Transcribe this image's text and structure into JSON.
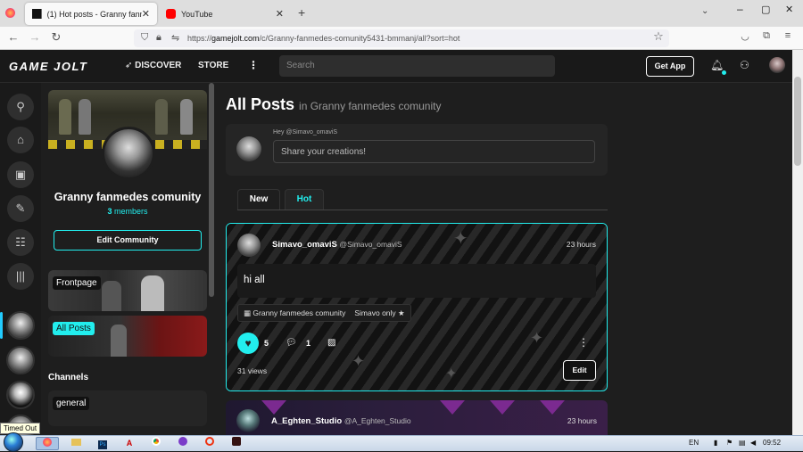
{
  "browser": {
    "tabs": [
      {
        "title": "(1) Hot posts - Granny fanmedes",
        "active": true
      },
      {
        "title": "YouTube",
        "active": false
      }
    ],
    "url_prefix": "https://",
    "url_domain": "gamejolt.com",
    "url_path": "/c/Granny-fanmedes-comunity5431-bmmanj/all?sort=hot"
  },
  "header": {
    "logo": "GAME JOLT",
    "discover": "DISCOVER",
    "store": "STORE",
    "search_placeholder": "Search",
    "get_app": "Get App"
  },
  "rail": {
    "timed_out": "Timed Out"
  },
  "community": {
    "name": "Granny fanmedes comunity",
    "member_count": "3",
    "members_label": "members",
    "edit_button": "Edit Community",
    "channels_heading": "Channels",
    "cards": [
      {
        "label": "Frontpage"
      },
      {
        "label": "All Posts"
      }
    ],
    "channels": [
      {
        "label": "general"
      }
    ]
  },
  "feed": {
    "title": "All Posts",
    "subtitle": "in Granny fanmedes comunity",
    "composer": {
      "hey": "Hey @Simavo_omaviS",
      "placeholder": "Share your creations!"
    },
    "tabs": [
      {
        "label": "New"
      },
      {
        "label": "Hot",
        "active": true
      }
    ],
    "posts": [
      {
        "display_name": "Simavo_omaviS",
        "handle": "@Simavo_omaviS",
        "time": "23 hours",
        "body": "hi all",
        "community_tag": "Granny fanmedes comunity",
        "channel_tag": "Simavo only",
        "likes": "5",
        "comments": "1",
        "views": "31 views",
        "edit_label": "Edit"
      },
      {
        "display_name": "A_Eghten_Studio",
        "handle": "@A_Eghten_Studio",
        "time": "23 hours"
      }
    ]
  },
  "taskbar": {
    "lang": "EN",
    "clock": "09:52"
  },
  "colors": {
    "accent": "#22eeee",
    "header_bg": "#191919",
    "page_bg": "#1e1e1e"
  }
}
